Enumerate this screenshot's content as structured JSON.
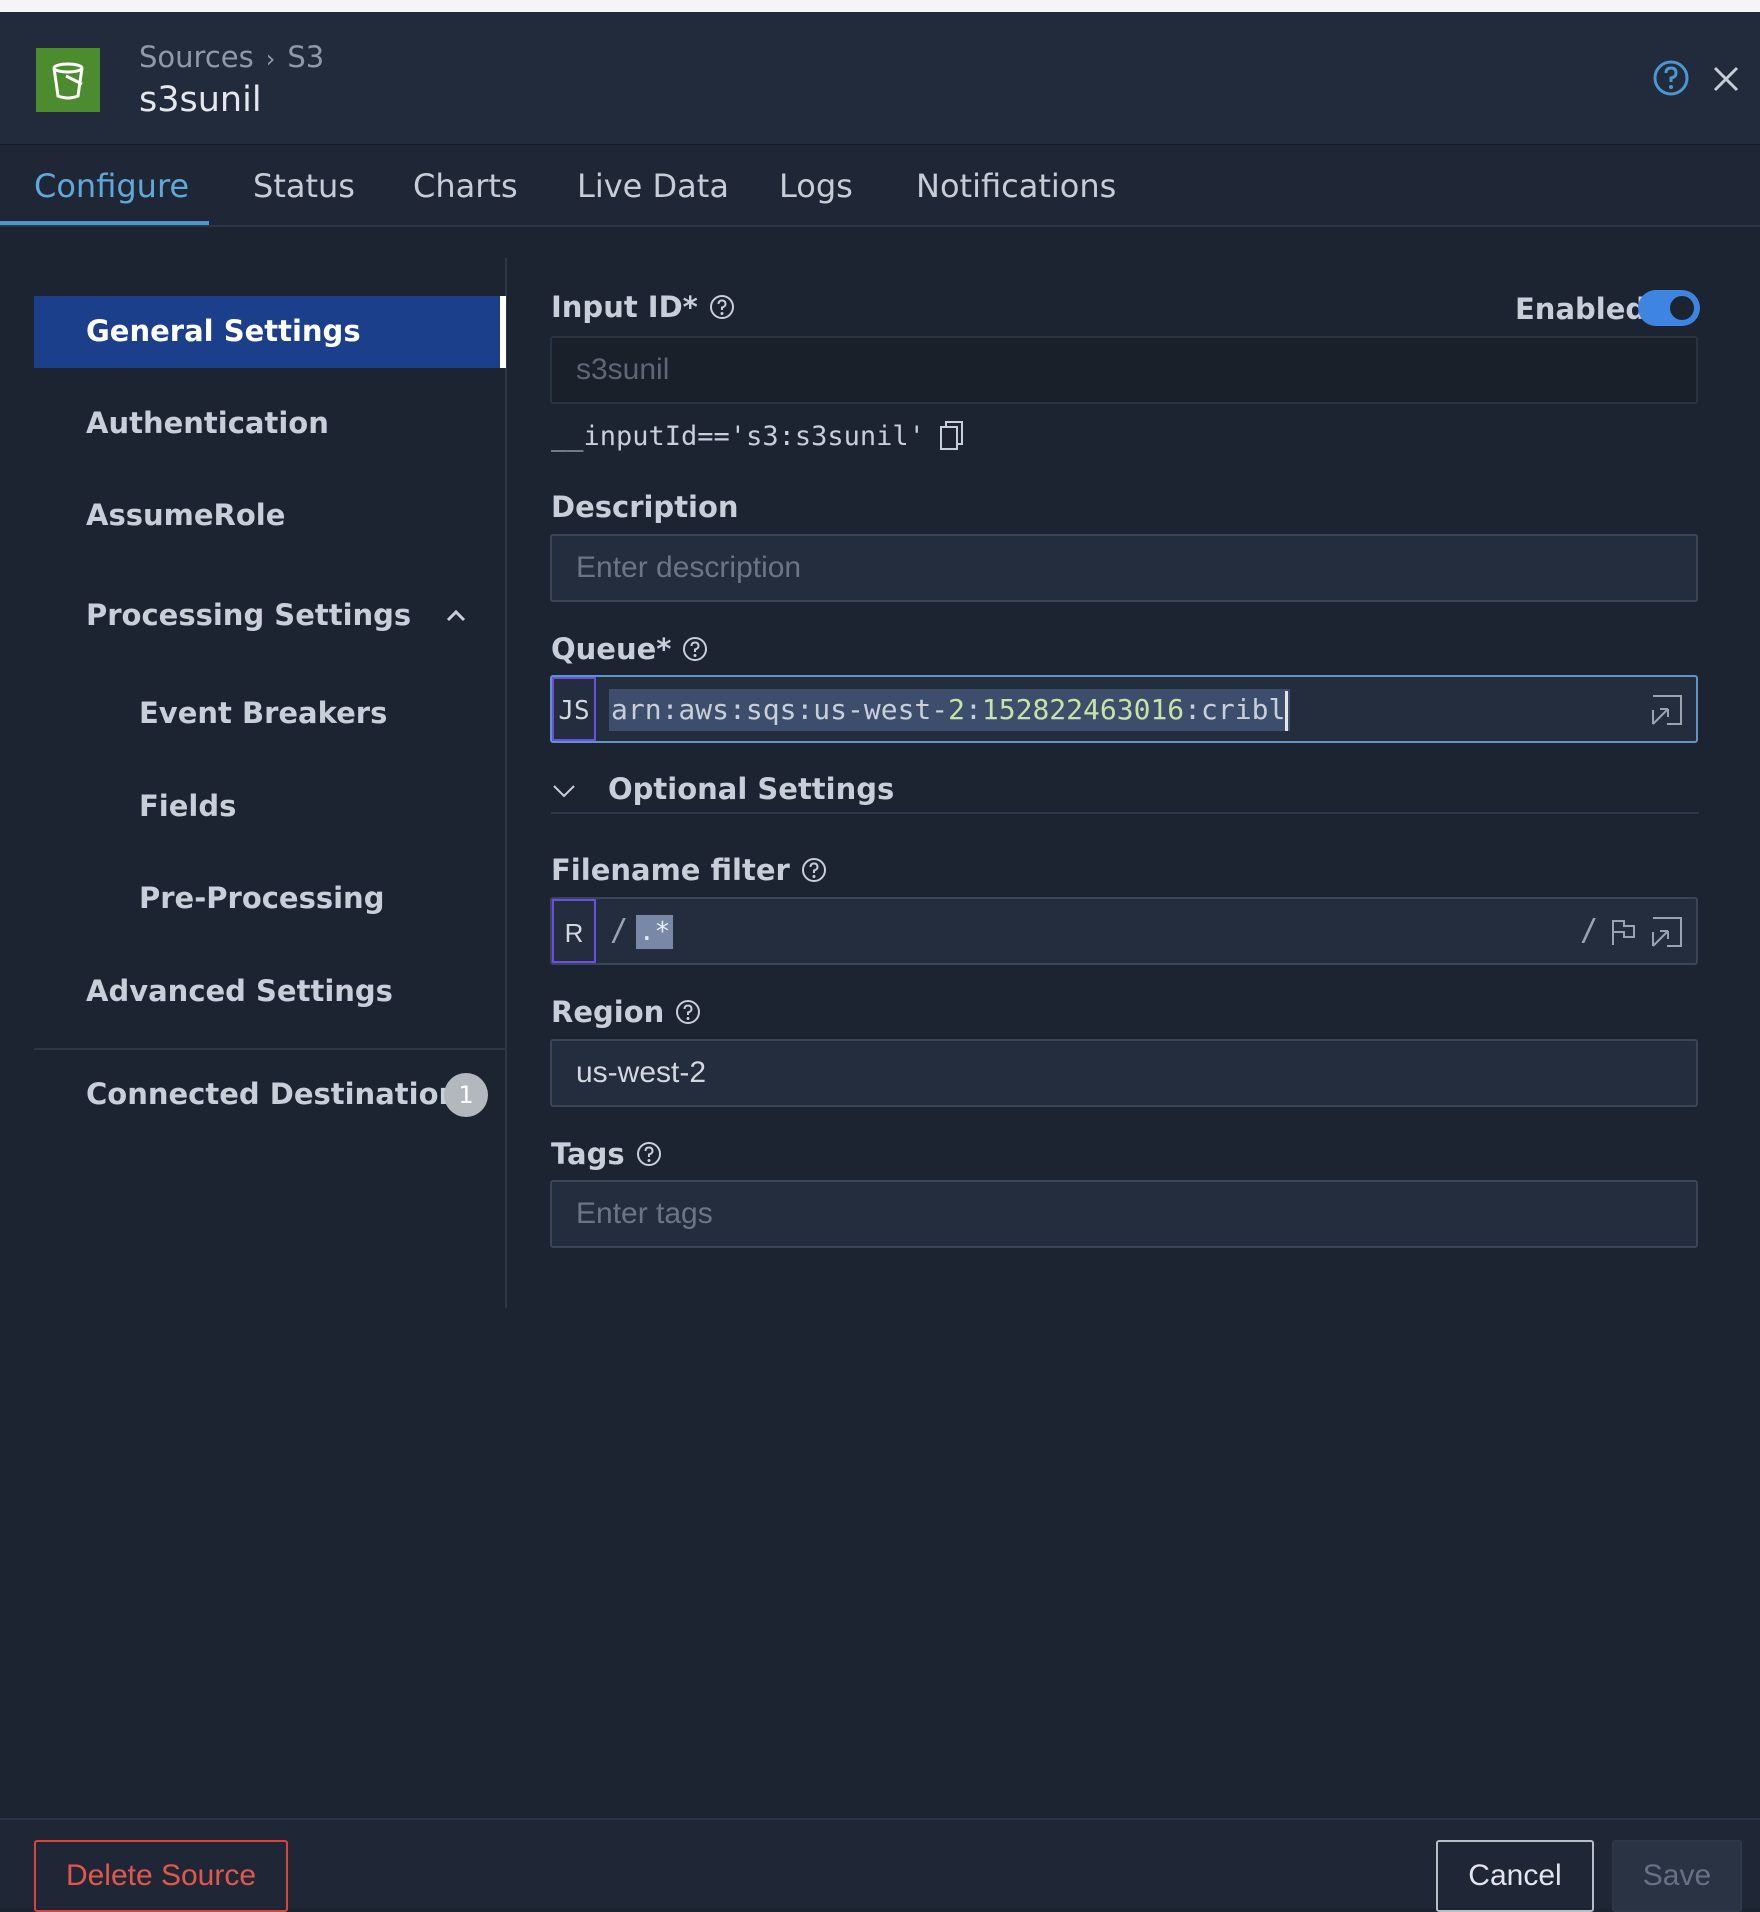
{
  "header": {
    "breadcrumb": [
      "Sources",
      "S3"
    ],
    "breadcrumb_separator": "›",
    "title": "s3sunil",
    "icons": [
      "s3-bucket-icon",
      "help-icon",
      "close-icon"
    ]
  },
  "tabs": [
    {
      "label": "Configure",
      "active": true
    },
    {
      "label": "Status"
    },
    {
      "label": "Charts"
    },
    {
      "label": "Live Data"
    },
    {
      "label": "Logs"
    },
    {
      "label": "Notifications"
    }
  ],
  "sidebar": {
    "items": [
      {
        "label": "General Settings",
        "active": true
      },
      {
        "label": "Authentication"
      },
      {
        "label": "AssumeRole"
      },
      {
        "label": "Processing Settings",
        "expanded": true
      },
      {
        "label": "Event Breakers"
      },
      {
        "label": "Fields"
      },
      {
        "label": "Pre-Processing"
      },
      {
        "label": "Advanced Settings"
      },
      {
        "label": "Connected Destinations",
        "badge": "1"
      }
    ]
  },
  "form": {
    "input_id_label": "Input ID*",
    "enabled_label": "Enabled",
    "enabled": true,
    "input_id_value": "s3sunil",
    "input_id_expr": "__inputId=='s3:s3sunil'",
    "description_label": "Description",
    "description_placeholder": "Enter description",
    "queue_label": "Queue*",
    "queue_mode": "JS",
    "queue_value_parts": [
      "arn:aws:sqs:us-west-",
      "2",
      ":",
      "152822463016",
      ":cribl"
    ],
    "optional_settings_label": "Optional Settings",
    "filename_filter_label": "Filename filter",
    "filename_filter_mode": "R",
    "filename_filter_delim": "/",
    "filename_filter_value": ".*",
    "region_label": "Region",
    "region_value": "us-west-2",
    "tags_label": "Tags",
    "tags_placeholder": "Enter tags"
  },
  "footer": {
    "delete_label": "Delete Source",
    "cancel_label": "Cancel",
    "save_label": "Save"
  },
  "colors": {
    "background": "#1c2331",
    "accent": "#4a98cf",
    "active_nav": "#1c3f8c",
    "toggle": "#3d85e0",
    "danger": "#d8453c",
    "logo": "#4c8c2f"
  }
}
